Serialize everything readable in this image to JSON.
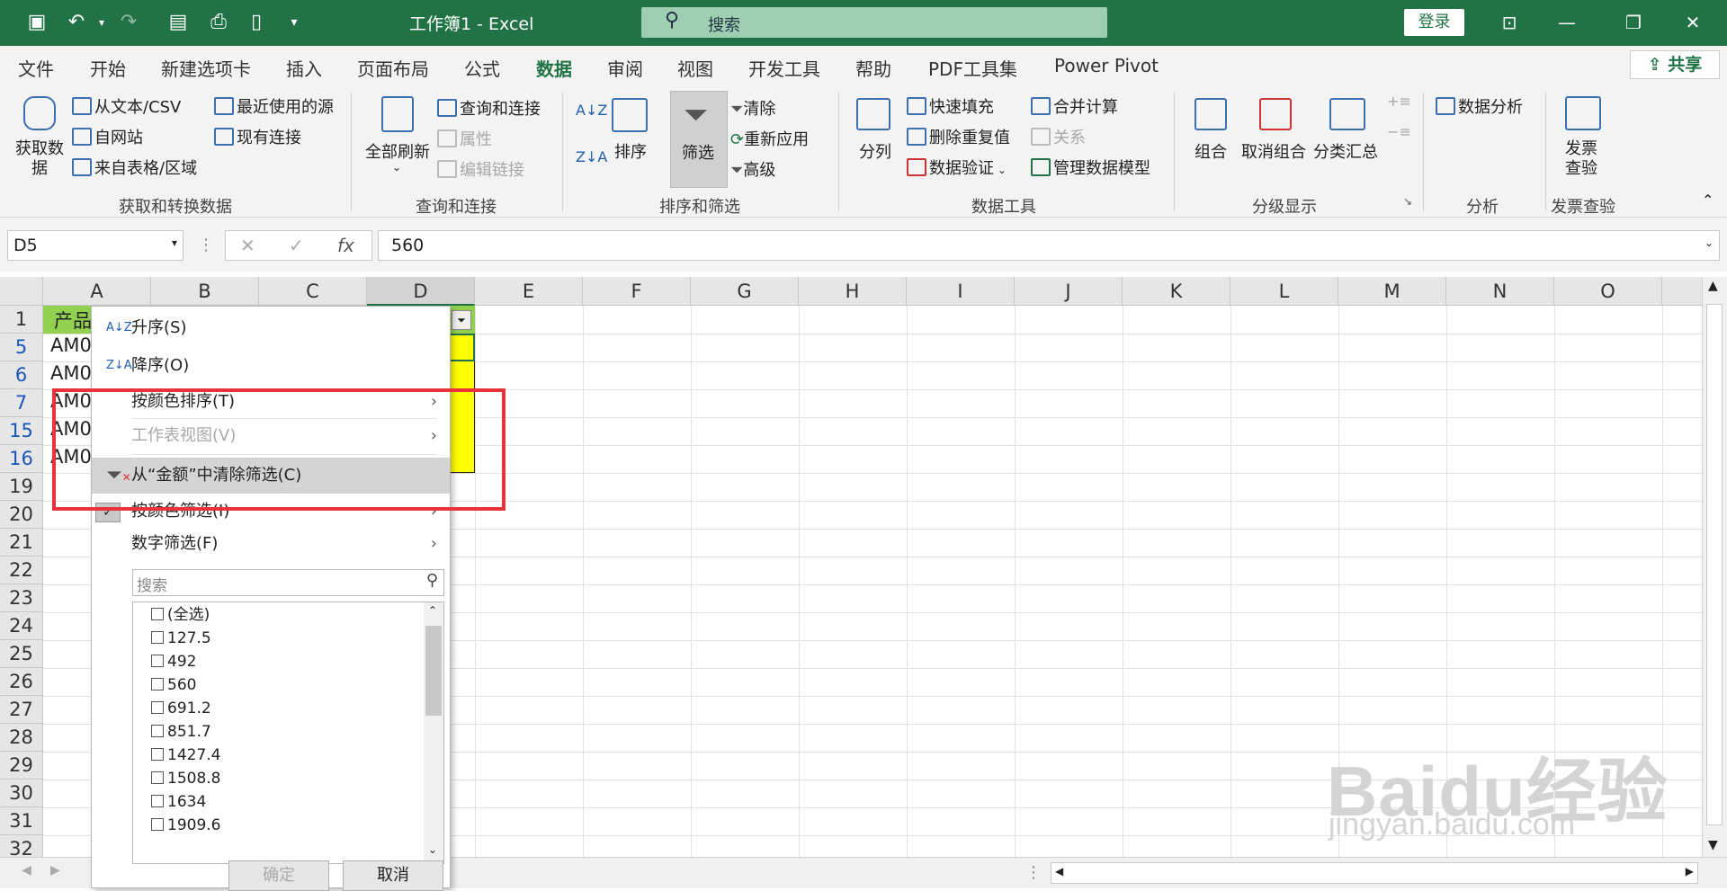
{
  "titlebar": {
    "doc_title": "工作簿1  -  Excel",
    "search_placeholder": "搜索",
    "login": "登录"
  },
  "tabs": [
    "文件",
    "开始",
    "新建选项卡",
    "插入",
    "页面布局",
    "公式",
    "数据",
    "审阅",
    "视图",
    "开发工具",
    "帮助",
    "PDF工具集",
    "Power Pivot"
  ],
  "share": "共享",
  "ribbon": {
    "get_data": "获取数\n据",
    "from_text": "从文本/CSV",
    "from_web": "自网站",
    "from_table": "来自表格/区域",
    "recent_sources": "最近使用的源",
    "existing_conn": "现有连接",
    "group1": "获取和转换数据",
    "refresh_all": "全部刷新",
    "query_conn": "查询和连接",
    "properties": "属性",
    "edit_links": "编辑链接",
    "group2": "查询和连接",
    "sort": "排序",
    "filter": "筛选",
    "clear": "清除",
    "reapply": "重新应用",
    "advanced": "高级",
    "group3": "排序和筛选",
    "split": "分列",
    "flash_fill": "快速填充",
    "remove_dup": "删除重复值",
    "data_valid": "数据验证",
    "consolidate": "合并计算",
    "relations": "关系",
    "manage_model": "管理数据模型",
    "group4": "数据工具",
    "group_btn": "组合",
    "ungroup": "取消组合",
    "subtotal": "分类汇总",
    "group5": "分级显示",
    "data_analysis": "数据分析",
    "group6": "分析",
    "invoice": "发票\n查验",
    "group7": "发票查验"
  },
  "formula": {
    "namebox": "D5",
    "value": "560"
  },
  "columns": [
    "A",
    "B",
    "C",
    "D",
    "E",
    "F",
    "G",
    "H",
    "I",
    "J",
    "K",
    "L",
    "M",
    "N",
    "O"
  ],
  "rows": [
    "1",
    "5",
    "6",
    "7",
    "15",
    "16",
    "19",
    "20",
    "21",
    "22",
    "23",
    "24",
    "25",
    "26",
    "27",
    "28",
    "29",
    "30",
    "31",
    "32"
  ],
  "cells": {
    "a1": "产品",
    "a_vals": [
      "AM0",
      "AM0",
      "AM0",
      "AM0",
      "AM0"
    ]
  },
  "dropdown": {
    "sort_asc": "升序(S)",
    "sort_desc": "降序(O)",
    "sort_color": "按颜色排序(T)",
    "sheet_view": "工作表视图(V)",
    "clear_filter": "从“金额”中清除筛选(C)",
    "filter_color": "按颜色筛选(I)",
    "number_filter": "数字筛选(F)",
    "search_placeholder": "搜索",
    "items": [
      "(全选)",
      "127.5",
      "492",
      "560",
      "691.2",
      "851.7",
      "1427.4",
      "1508.8",
      "1634",
      "1909.6"
    ],
    "ok": "确定",
    "cancel": "取消"
  },
  "watermark": {
    "line1": "Baidu经验",
    "line2": "jingyan.baidu.com"
  },
  "colors": {
    "excel_green": "#217346",
    "highlight_yellow": "#ffff00",
    "header_green": "#92d050",
    "annotation_red": "#e8333a"
  }
}
